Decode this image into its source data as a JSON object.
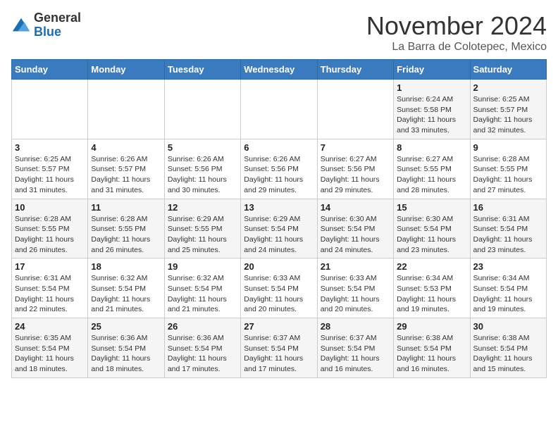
{
  "header": {
    "logo_general": "General",
    "logo_blue": "Blue",
    "month_title": "November 2024",
    "location": "La Barra de Colotepec, Mexico"
  },
  "weekdays": [
    "Sunday",
    "Monday",
    "Tuesday",
    "Wednesday",
    "Thursday",
    "Friday",
    "Saturday"
  ],
  "weeks": [
    [
      {
        "day": "",
        "info": ""
      },
      {
        "day": "",
        "info": ""
      },
      {
        "day": "",
        "info": ""
      },
      {
        "day": "",
        "info": ""
      },
      {
        "day": "",
        "info": ""
      },
      {
        "day": "1",
        "info": "Sunrise: 6:24 AM\nSunset: 5:58 PM\nDaylight: 11 hours\nand 33 minutes."
      },
      {
        "day": "2",
        "info": "Sunrise: 6:25 AM\nSunset: 5:57 PM\nDaylight: 11 hours\nand 32 minutes."
      }
    ],
    [
      {
        "day": "3",
        "info": "Sunrise: 6:25 AM\nSunset: 5:57 PM\nDaylight: 11 hours\nand 31 minutes."
      },
      {
        "day": "4",
        "info": "Sunrise: 6:26 AM\nSunset: 5:57 PM\nDaylight: 11 hours\nand 31 minutes."
      },
      {
        "day": "5",
        "info": "Sunrise: 6:26 AM\nSunset: 5:56 PM\nDaylight: 11 hours\nand 30 minutes."
      },
      {
        "day": "6",
        "info": "Sunrise: 6:26 AM\nSunset: 5:56 PM\nDaylight: 11 hours\nand 29 minutes."
      },
      {
        "day": "7",
        "info": "Sunrise: 6:27 AM\nSunset: 5:56 PM\nDaylight: 11 hours\nand 29 minutes."
      },
      {
        "day": "8",
        "info": "Sunrise: 6:27 AM\nSunset: 5:55 PM\nDaylight: 11 hours\nand 28 minutes."
      },
      {
        "day": "9",
        "info": "Sunrise: 6:28 AM\nSunset: 5:55 PM\nDaylight: 11 hours\nand 27 minutes."
      }
    ],
    [
      {
        "day": "10",
        "info": "Sunrise: 6:28 AM\nSunset: 5:55 PM\nDaylight: 11 hours\nand 26 minutes."
      },
      {
        "day": "11",
        "info": "Sunrise: 6:28 AM\nSunset: 5:55 PM\nDaylight: 11 hours\nand 26 minutes."
      },
      {
        "day": "12",
        "info": "Sunrise: 6:29 AM\nSunset: 5:55 PM\nDaylight: 11 hours\nand 25 minutes."
      },
      {
        "day": "13",
        "info": "Sunrise: 6:29 AM\nSunset: 5:54 PM\nDaylight: 11 hours\nand 24 minutes."
      },
      {
        "day": "14",
        "info": "Sunrise: 6:30 AM\nSunset: 5:54 PM\nDaylight: 11 hours\nand 24 minutes."
      },
      {
        "day": "15",
        "info": "Sunrise: 6:30 AM\nSunset: 5:54 PM\nDaylight: 11 hours\nand 23 minutes."
      },
      {
        "day": "16",
        "info": "Sunrise: 6:31 AM\nSunset: 5:54 PM\nDaylight: 11 hours\nand 23 minutes."
      }
    ],
    [
      {
        "day": "17",
        "info": "Sunrise: 6:31 AM\nSunset: 5:54 PM\nDaylight: 11 hours\nand 22 minutes."
      },
      {
        "day": "18",
        "info": "Sunrise: 6:32 AM\nSunset: 5:54 PM\nDaylight: 11 hours\nand 21 minutes."
      },
      {
        "day": "19",
        "info": "Sunrise: 6:32 AM\nSunset: 5:54 PM\nDaylight: 11 hours\nand 21 minutes."
      },
      {
        "day": "20",
        "info": "Sunrise: 6:33 AM\nSunset: 5:54 PM\nDaylight: 11 hours\nand 20 minutes."
      },
      {
        "day": "21",
        "info": "Sunrise: 6:33 AM\nSunset: 5:54 PM\nDaylight: 11 hours\nand 20 minutes."
      },
      {
        "day": "22",
        "info": "Sunrise: 6:34 AM\nSunset: 5:53 PM\nDaylight: 11 hours\nand 19 minutes."
      },
      {
        "day": "23",
        "info": "Sunrise: 6:34 AM\nSunset: 5:54 PM\nDaylight: 11 hours\nand 19 minutes."
      }
    ],
    [
      {
        "day": "24",
        "info": "Sunrise: 6:35 AM\nSunset: 5:54 PM\nDaylight: 11 hours\nand 18 minutes."
      },
      {
        "day": "25",
        "info": "Sunrise: 6:36 AM\nSunset: 5:54 PM\nDaylight: 11 hours\nand 18 minutes."
      },
      {
        "day": "26",
        "info": "Sunrise: 6:36 AM\nSunset: 5:54 PM\nDaylight: 11 hours\nand 17 minutes."
      },
      {
        "day": "27",
        "info": "Sunrise: 6:37 AM\nSunset: 5:54 PM\nDaylight: 11 hours\nand 17 minutes."
      },
      {
        "day": "28",
        "info": "Sunrise: 6:37 AM\nSunset: 5:54 PM\nDaylight: 11 hours\nand 16 minutes."
      },
      {
        "day": "29",
        "info": "Sunrise: 6:38 AM\nSunset: 5:54 PM\nDaylight: 11 hours\nand 16 minutes."
      },
      {
        "day": "30",
        "info": "Sunrise: 6:38 AM\nSunset: 5:54 PM\nDaylight: 11 hours\nand 15 minutes."
      }
    ]
  ]
}
